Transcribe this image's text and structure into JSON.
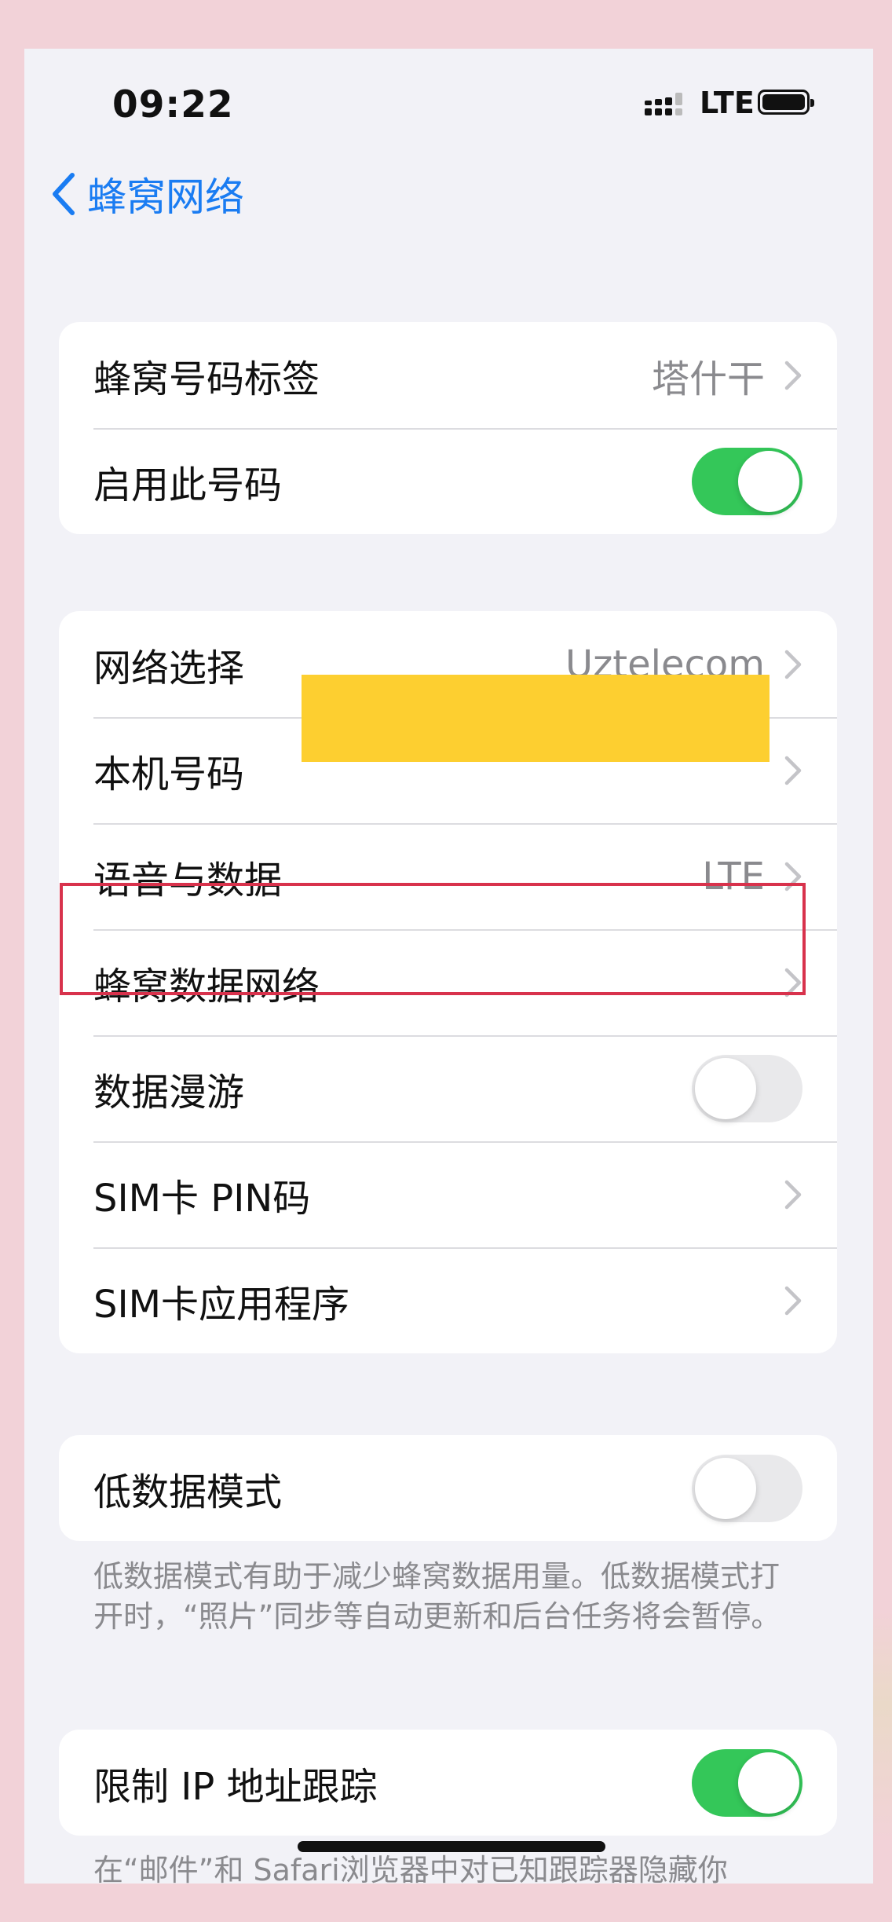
{
  "status_bar": {
    "time": "09:22",
    "network": "LTE"
  },
  "nav": {
    "back_icon": "chevron-left-icon",
    "title": "蜂窝网络"
  },
  "group1": {
    "number_label": {
      "label": "蜂窝号码标签",
      "value": "塔什干"
    },
    "enable_number": {
      "label": "启用此号码",
      "on": true
    }
  },
  "group2": {
    "network_selection": {
      "label": "网络选择",
      "value": "Uztelecom"
    },
    "my_number": {
      "label": "本机号码"
    },
    "voice_data": {
      "label": "语音与数据",
      "value": "LTE"
    },
    "cellular_data_network": {
      "label": "蜂窝数据网络"
    },
    "data_roaming": {
      "label": "数据漫游",
      "on": false
    },
    "sim_pin": {
      "label": "SIM卡 PIN码"
    },
    "sim_apps": {
      "label": "SIM卡应用程序"
    }
  },
  "group3": {
    "low_data_mode": {
      "label": "低数据模式",
      "on": false
    },
    "footer": "低数据模式有助于减少蜂窝数据用量。低数据模式打开时，“照片”同步等自动更新和后台任务将会暂停。"
  },
  "group4": {
    "limit_ip_tracking": {
      "label": "限制 IP 地址跟踪",
      "on": true
    },
    "footer": "在“邮件”和 Safari浏览器中对已知跟踪器隐藏你"
  },
  "colors": {
    "accent": "#1a7cf2",
    "toggle_on": "#34c759",
    "highlight": "#d8324c",
    "redaction": "#fdcf30"
  }
}
